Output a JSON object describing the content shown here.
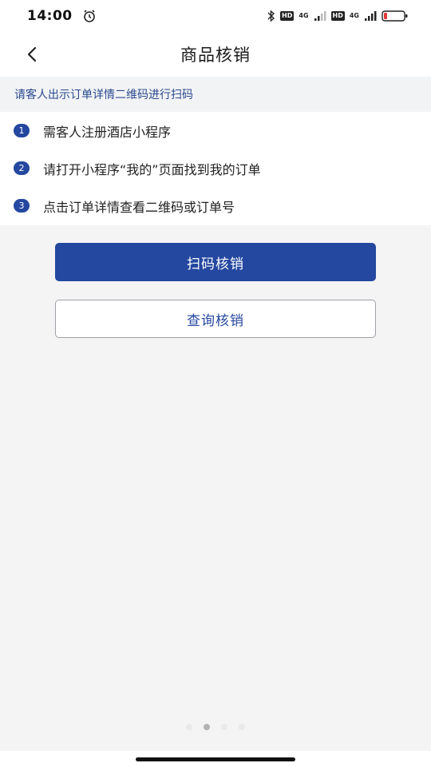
{
  "status_bar": {
    "time": "14:00",
    "icons": [
      "alarm-icon",
      "bluetooth-icon",
      "hd-badge",
      "signal-icon",
      "hd-badge",
      "4g-signal-icon",
      "battery-icon"
    ],
    "hd_label": "HD",
    "net_label_1": "4G",
    "net_label_2": "4G"
  },
  "header": {
    "title": "商品核销",
    "back_icon": "chevron-left-icon"
  },
  "hint": {
    "text": "请客人出示订单详情二维码进行扫码"
  },
  "steps": [
    {
      "number": "1",
      "text": "需客人注册酒店小程序"
    },
    {
      "number": "2",
      "text": "请打开小程序“我的”页面找到我的订单"
    },
    {
      "number": "3",
      "text": "点击订单详情查看二维码或订单号"
    }
  ],
  "actions": {
    "scan_label": "扫码核销",
    "query_label": "查询核销"
  },
  "pager": {
    "total": 4,
    "active_index": 1
  },
  "colors": {
    "primary": "#24479f",
    "hint_text": "#2a4a8e",
    "background": "#f4f4f5"
  }
}
